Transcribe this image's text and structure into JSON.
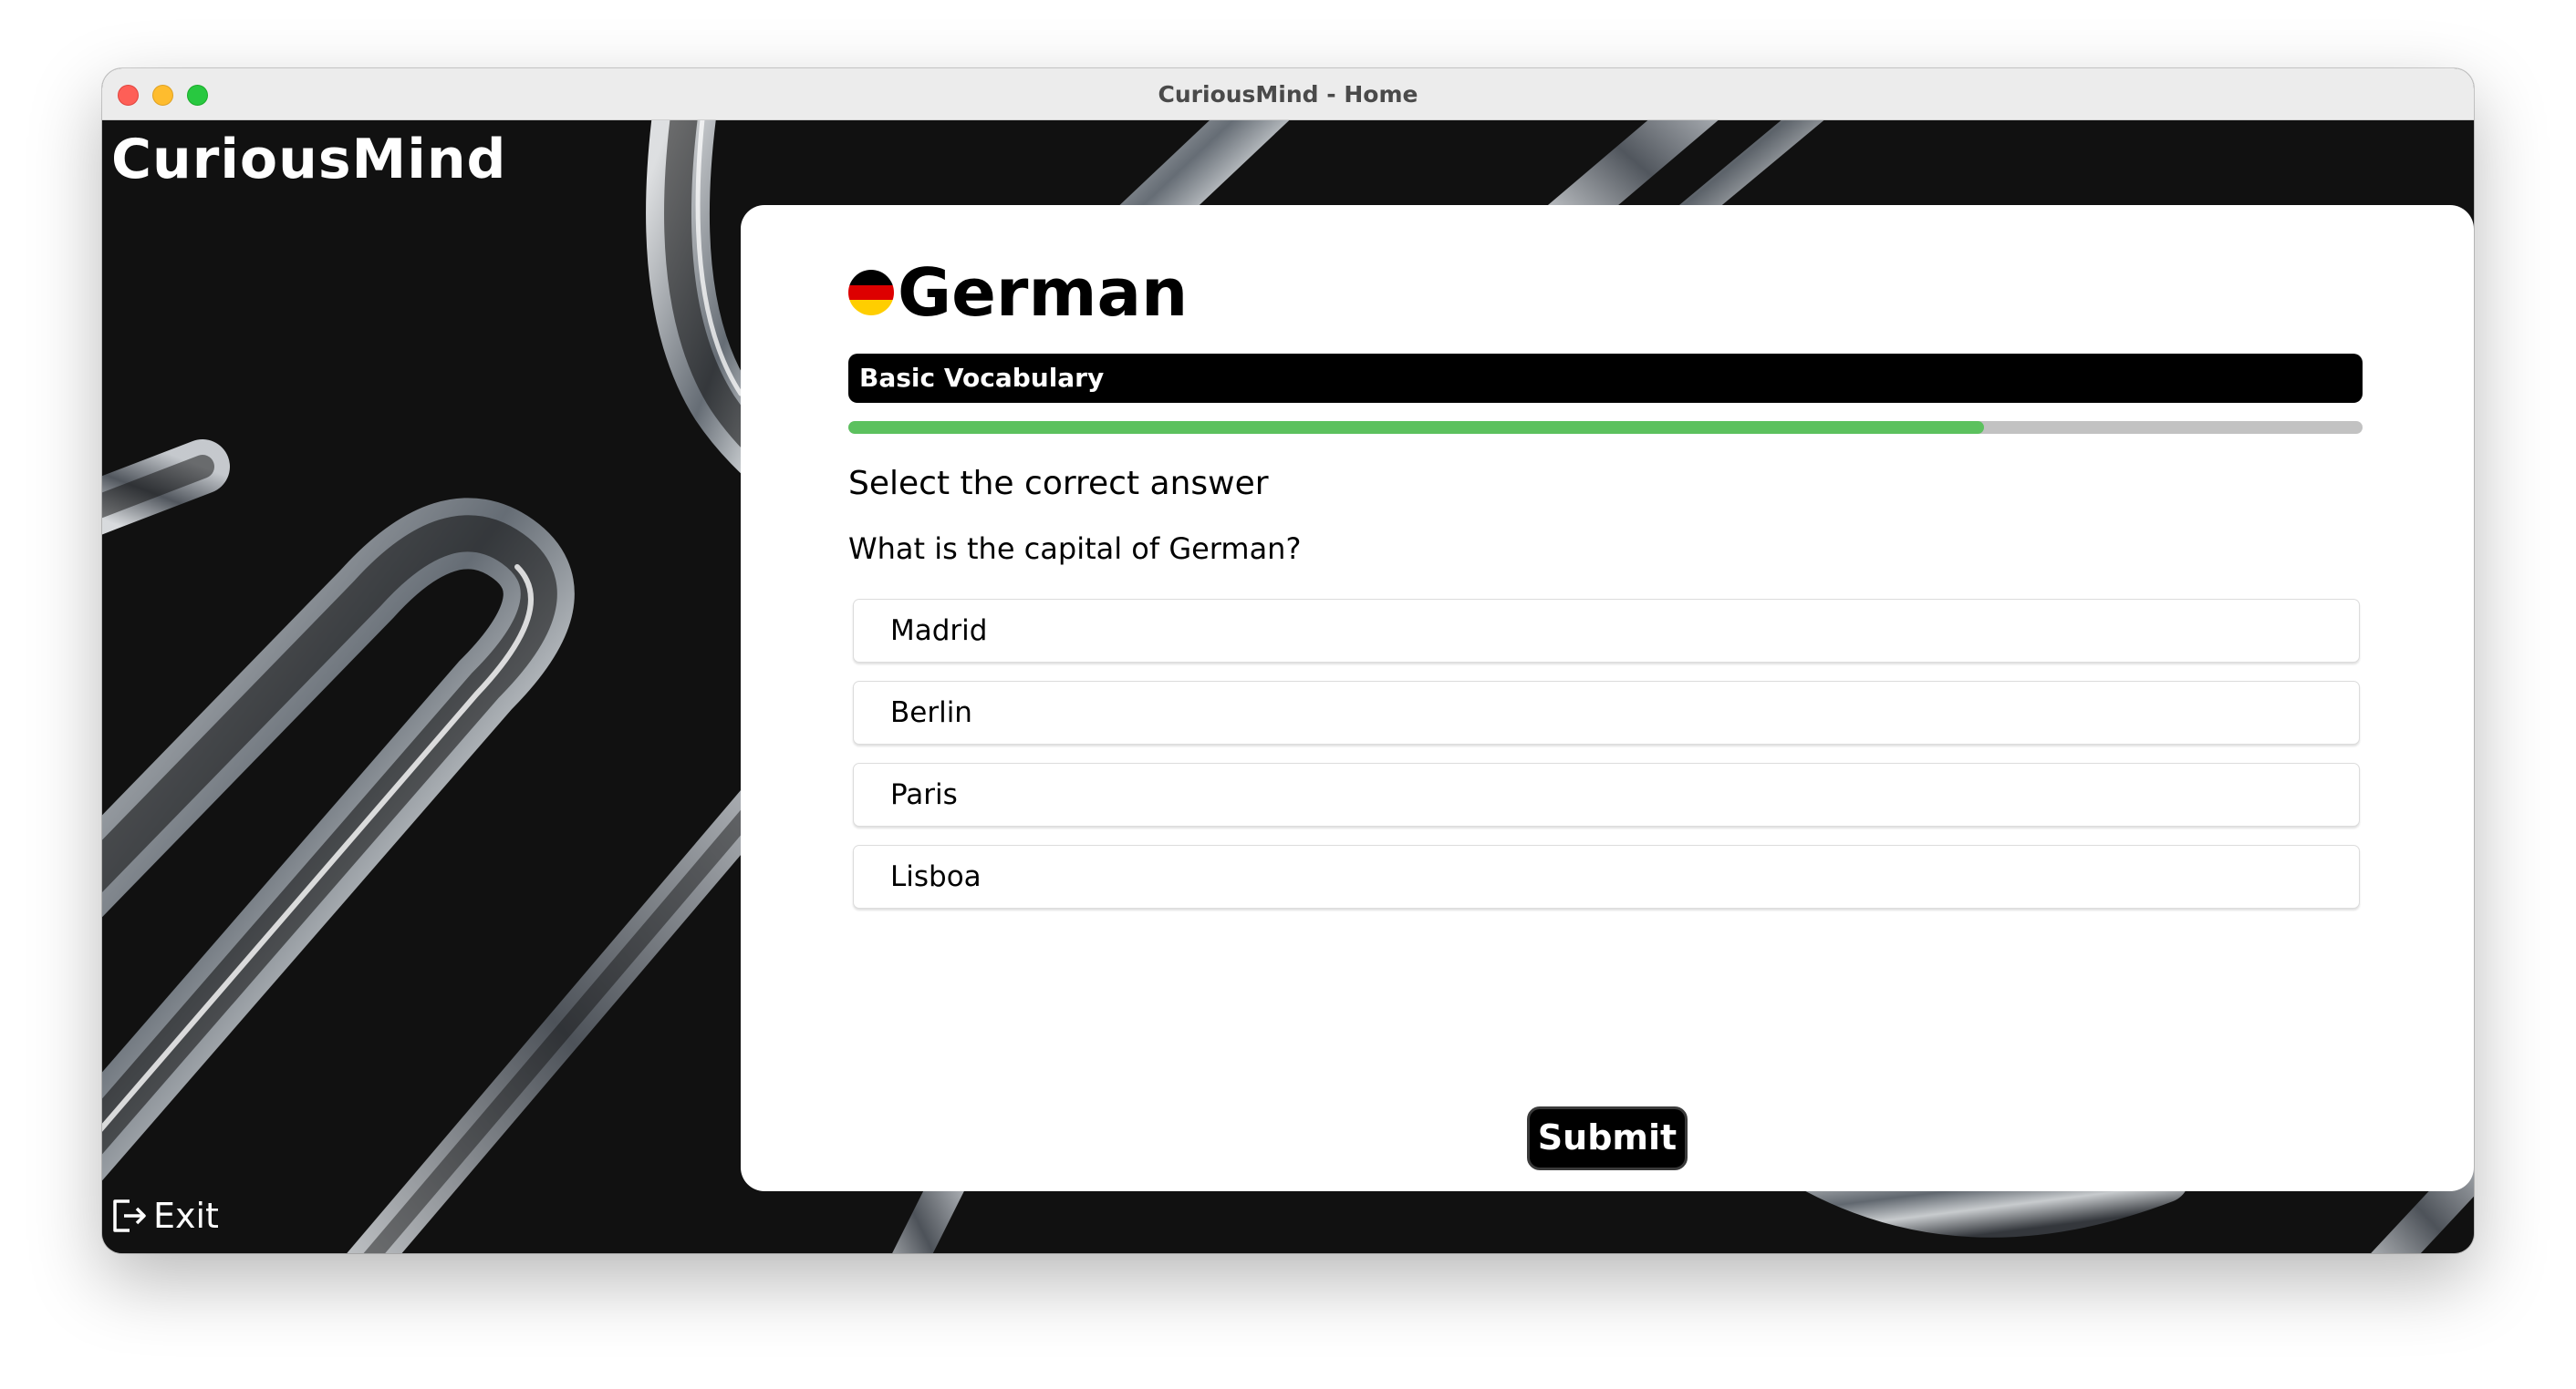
{
  "window": {
    "title": "CuriousMind - Home"
  },
  "sidebar": {
    "brand": "CuriousMind",
    "exit_label": "Exit"
  },
  "quiz": {
    "language": "German",
    "flag_icon": "germany-flag-icon",
    "topic": "Basic Vocabulary",
    "progress_fraction": 0.75,
    "instruction": "Select the correct answer",
    "question": "What is the capital of German?",
    "options": [
      "Madrid",
      "Berlin",
      "Paris",
      "Lisboa"
    ],
    "submit_label": "Submit"
  },
  "colors": {
    "progress_fill": "#5cc15e",
    "progress_track": "#c2c2c2",
    "topic_bar": "#000000",
    "background": "#111111"
  }
}
